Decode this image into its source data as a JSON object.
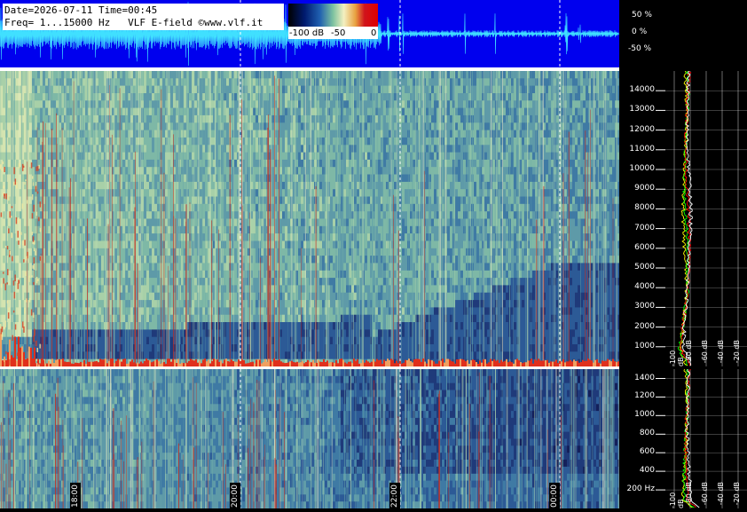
{
  "header": {
    "line1": "Date=2026-07-11 Time=00:45",
    "line2": "Freq= 1...15000 Hz   VLF E-field ©www.vlf.it"
  },
  "colorbar": {
    "labels": [
      "-100 dB",
      "-50",
      "0"
    ]
  },
  "waveform": {
    "scale_labels": [
      "50 %",
      "0 %",
      "-50 %"
    ]
  },
  "chart_data": [
    {
      "type": "heatmap",
      "title": "",
      "frequency_ticks_hz": [
        "14000",
        "13000",
        "12000",
        "11000",
        "10000",
        "9000",
        "8000",
        "7000",
        "6000",
        "5000",
        "4000",
        "3000",
        "2000",
        "1000"
      ],
      "ylim": [
        0,
        15000
      ],
      "time_ticks": [
        "18:00",
        "20:00",
        "22:00",
        "00:00"
      ],
      "colorscale_db": [
        -100,
        0
      ]
    },
    {
      "type": "heatmap",
      "frequency_ticks_hz": [
        "1400",
        "1200",
        "1000",
        "800",
        "600",
        "400",
        "200 Hz"
      ],
      "ylim": [
        0,
        1500
      ],
      "time_ticks": [
        "18:00",
        "20:00",
        "22:00",
        "00:00"
      ]
    },
    {
      "type": "line",
      "xlabel_ticks": [
        "-100 dB",
        "-80 dB",
        "-60 dB",
        "-40 dB",
        "-20 dB"
      ],
      "series": [
        {
          "color": "#ffff00"
        },
        {
          "color": "#00ff00"
        },
        {
          "color": "#ff0000"
        },
        {
          "color": "#ffffff"
        }
      ]
    }
  ],
  "colors": {
    "waveform_bg": "#0000ee",
    "waveform_trace": "#40e0ff"
  }
}
